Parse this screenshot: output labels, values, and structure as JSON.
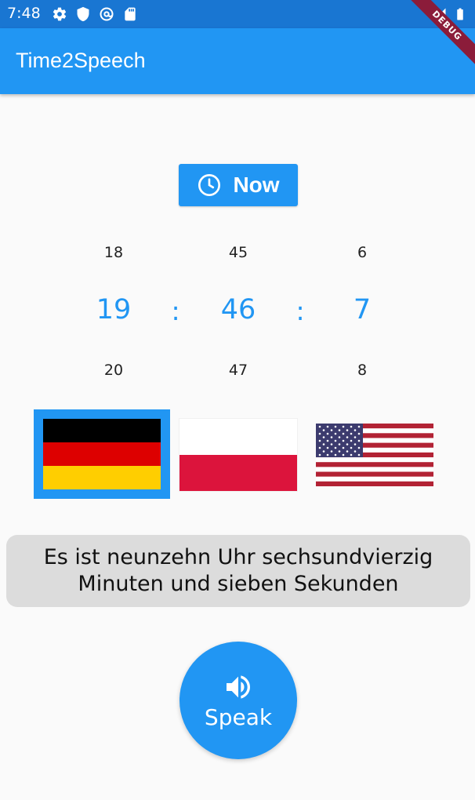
{
  "status_bar": {
    "time": "7:48",
    "icons": [
      "gear-icon",
      "shield-icon",
      "at-sign-icon",
      "sd-card-icon"
    ],
    "right_icons": [
      "signal-icon",
      "battery-icon"
    ]
  },
  "app_bar": {
    "title": "Time2Speech"
  },
  "debug_banner": {
    "label": "DEBUG"
  },
  "now_button": {
    "label": "Now",
    "icon": "clock-icon"
  },
  "time_picker": {
    "hours": {
      "prev": "18",
      "selected": "19",
      "next": "20"
    },
    "minutes": {
      "prev": "45",
      "selected": "46",
      "next": "47"
    },
    "seconds": {
      "prev": "6",
      "selected": "7",
      "next": "8"
    },
    "separator": ":"
  },
  "languages": {
    "selected": "de",
    "flags": [
      "de",
      "pl",
      "us"
    ]
  },
  "speech": {
    "text": "Es ist neunzehn Uhr sechsundvierzig Minuten und sieben Sekunden"
  },
  "speak_button": {
    "label": "Speak",
    "icon": "volume-icon"
  },
  "colors": {
    "primary": "#2196f3",
    "status_bar": "#1976d2",
    "speech_bg": "#dcdcdc",
    "debug": "#8b1c3a"
  }
}
